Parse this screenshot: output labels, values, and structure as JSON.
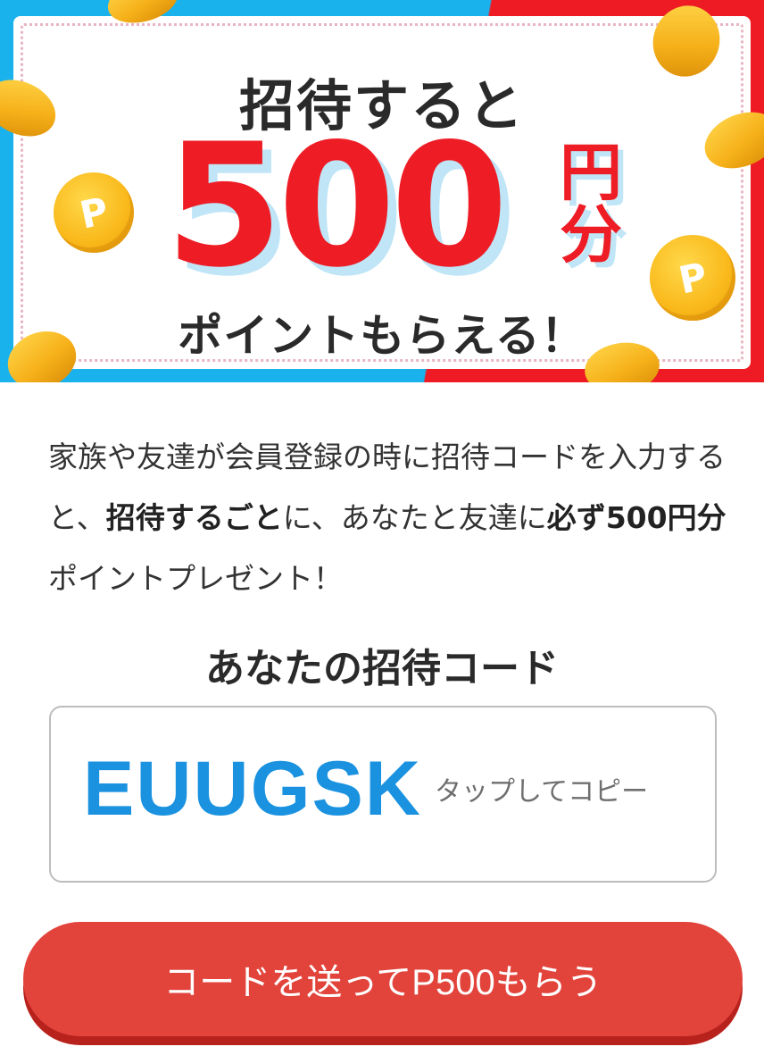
{
  "banner": {
    "headline_top": "招待すると",
    "amount": "500",
    "unit_en": "円",
    "unit_bun": "分",
    "headline_bottom": "ポイントもらえる！",
    "coin_mark": "P",
    "colors": {
      "left_band": "#1ab2ec",
      "right_band": "#ee1b24",
      "amount": "#ee1c25"
    }
  },
  "description": {
    "part1": "家族や友達が会員登録の時に招待コードを入力すると、",
    "bold1": "招待するごと",
    "part2": "に、あなたと友達に",
    "bold2": "必ず500円分",
    "part3": "ポイントプレゼント！"
  },
  "invite": {
    "title": "あなたの招待コード",
    "code": "EUUGSK",
    "copy_hint": "タップしてコピー",
    "code_color": "#1a92e0"
  },
  "send_button": {
    "label": "コードを送ってP500もらう",
    "color": "#e2443c"
  }
}
